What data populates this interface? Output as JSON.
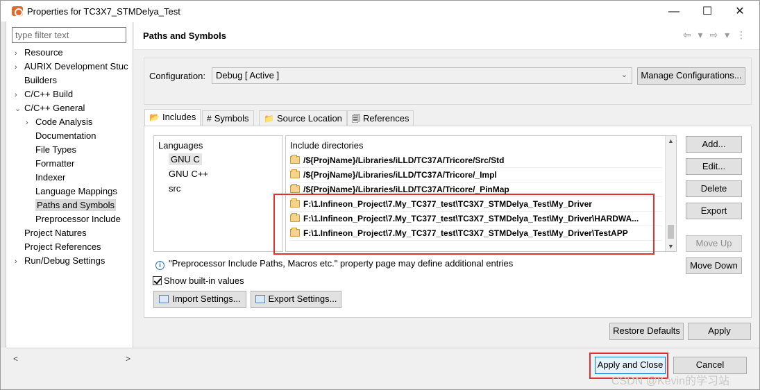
{
  "window": {
    "title": "Properties for TC3X7_STMDelya_Test",
    "minimize": "—",
    "maximize": "☐",
    "close": "✕"
  },
  "filter": {
    "placeholder": "type filter text"
  },
  "tree": [
    {
      "label": "Resource",
      "arrow": "›"
    },
    {
      "label": "AURIX Development Stuc",
      "arrow": "›"
    },
    {
      "label": "Builders",
      "arrow": ""
    },
    {
      "label": "C/C++ Build",
      "arrow": "›"
    },
    {
      "label": "C/C++ General",
      "arrow": "⌄"
    },
    {
      "label": "Code Analysis",
      "arrow": "›"
    },
    {
      "label": "Documentation",
      "arrow": ""
    },
    {
      "label": "File Types",
      "arrow": ""
    },
    {
      "label": "Formatter",
      "arrow": ""
    },
    {
      "label": "Indexer",
      "arrow": ""
    },
    {
      "label": "Language Mappings",
      "arrow": ""
    },
    {
      "label": "Paths and Symbols",
      "arrow": ""
    },
    {
      "label": "Preprocessor Include",
      "arrow": ""
    },
    {
      "label": "Project Natures",
      "arrow": ""
    },
    {
      "label": "Project References",
      "arrow": ""
    },
    {
      "label": "Run/Debug Settings",
      "arrow": "›"
    }
  ],
  "page": {
    "title": "Paths and Symbols"
  },
  "config": {
    "label": "Configuration:",
    "value": "Debug  [ Active ]",
    "manage_button": "Manage Configurations..."
  },
  "tabs": [
    {
      "label": "Includes",
      "icon": "includes-icon"
    },
    {
      "label": "Symbols",
      "icon": "hash-icon"
    },
    {
      "label": "Source Location",
      "icon": "source-folder-icon"
    },
    {
      "label": "References",
      "icon": "references-icon"
    }
  ],
  "languages": {
    "header": "Languages",
    "items": [
      "GNU C",
      "GNU C++",
      "src"
    ]
  },
  "include_dirs": {
    "header": "Include directories",
    "items": [
      "/${ProjName}/Libraries/iLLD/TC37A/Tricore/Src/Std",
      "/${ProjName}/Libraries/iLLD/TC37A/Tricore/_Impl",
      "/${ProjName}/Libraries/iLLD/TC37A/Tricore/_PinMap",
      "F:\\1.Infineon_Project\\7.My_TC377_test\\TC3X7_STMDelya_Test\\My_Driver",
      "F:\\1.Infineon_Project\\7.My_TC377_test\\TC3X7_STMDelya_Test\\My_Driver\\HARDWA...",
      "F:\\1.Infineon_Project\\7.My_TC377_test\\TC3X7_STMDelya_Test\\My_Driver\\TestAPP"
    ]
  },
  "side_buttons": {
    "add": "Add...",
    "edit": "Edit...",
    "delete": "Delete",
    "export": "Export",
    "move_up": "Move Up",
    "move_down": "Move Down"
  },
  "info": "\"Preprocessor Include Paths, Macros etc.\" property page may define additional entries",
  "show_builtin": "Show built-in values",
  "import_settings": "Import Settings...",
  "export_settings": "Export Settings...",
  "restore_defaults": "Restore Defaults",
  "apply": "Apply",
  "apply_close": "Apply and Close",
  "cancel": "Cancel",
  "watermark": "CSDN @Kevin的学习站"
}
